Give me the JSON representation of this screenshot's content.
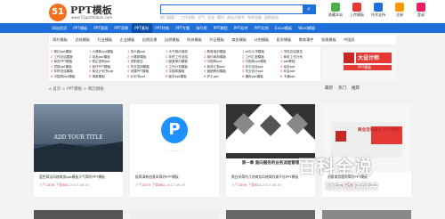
{
  "header": {
    "logo_text": "51",
    "brand": "PPT模板",
    "brand_url": "www.51pptmoban.com",
    "hot_label": "热门搜索：",
    "hot_words": [
      "工作总结",
      "大气",
      "毕业",
      "简约",
      "商业计划书",
      "年终总结",
      "述职报告"
    ],
    "search_icon": "search-icon",
    "quick_links": [
      {
        "label": "收藏本站",
        "color": "#4caf50"
      },
      {
        "label": "上传模板",
        "color": "#e53935"
      },
      {
        "label": "技术支持",
        "color": "#1e6fd9"
      },
      {
        "label": "注册",
        "color": "#ff9800"
      },
      {
        "label": "登录",
        "color": "#e91e63"
      }
    ]
  },
  "nav": [
    "网站首页",
    "PPT模板",
    "PPT图表",
    "PPT背景",
    "PPT素材",
    "PPT特效",
    "PPT专题",
    "排行榜",
    "PPT教程",
    "PPT软件",
    "PPT实例",
    "Excel模板",
    "Word模板"
  ],
  "nav_active": 4,
  "categories": [
    "简约模板",
    "总结模板",
    "行业模板",
    "企业模板",
    "自然风景",
    "自然模板",
    "科技模板",
    "节日模板",
    "商务模板",
    "计划模板",
    "医学模板",
    "教育课件",
    "党政模板",
    "中国风"
  ],
  "rank": [
    [
      "1",
      "简约ppt模板"
    ],
    [
      "1",
      "小清新ppt模板"
    ],
    [
      "1",
      "怎么做ppt"
    ],
    [
      "1",
      "大气简约商务"
    ],
    [
      "1",
      "教育培训模板"
    ],
    [
      "1",
      "pt中小学模板"
    ],
    [
      "1",
      "学校总结报告"
    ],
    [
      "2",
      "工作总结模板"
    ],
    [
      "2",
      "动态ppt模板"
    ],
    [
      "2",
      "小清新模板"
    ],
    [
      "2",
      "年终工作总结"
    ],
    [
      "2",
      "简约商务模板"
    ],
    [
      "2",
      "工作汇报模板"
    ],
    [
      "2",
      "商务工作计划"
    ],
    [
      "3",
      "商务PPT模板"
    ],
    [
      "3",
      "转正述职ppt"
    ],
    [
      "3",
      "述职报告"
    ],
    [
      "3",
      "欧美简约模板"
    ],
    [
      "3",
      "中国风ppt"
    ],
    [
      "3",
      "中国风ppt模板"
    ],
    [
      "3",
      "ppt教程"
    ],
    [
      "4",
      "党政ppt模板"
    ],
    [
      "4",
      "医疗PPT模板"
    ],
    [
      "4",
      "毕业答辩模板"
    ],
    [
      "4",
      "工作计划模板"
    ],
    [
      "4",
      "商务汇报ppt"
    ],
    [
      "4",
      "年中总结ppt"
    ],
    [
      "4",
      "动态ppt"
    ],
    [
      "5",
      "年终总结模板"
    ],
    [
      "5",
      "商业计划书ppt"
    ],
    [
      "5",
      "说课PPT模板"
    ],
    [
      "5",
      "中国风模板"
    ],
    [
      "5",
      "营销策划模板"
    ],
    [
      "5",
      "毕业设计ppt"
    ],
    [
      "5",
      "年会ppt"
    ],
    [
      "6",
      "中国风ppt模板"
    ],
    [
      "6",
      "清新模板"
    ],
    [
      "6",
      "计划书ppt"
    ],
    [
      "6",
      "医学ppt模板"
    ],
    [
      "6",
      "护士ppt"
    ],
    [
      "6",
      "通用ppt模板"
    ],
    [
      "6",
      "卡通ppt"
    ]
  ],
  "banner": {
    "title": "大设计师",
    "subtitle": "PPT模板"
  },
  "breadcrumb": "首页 > PPT模板 > 简历模板",
  "sort": [
    "最新",
    "热门",
    "推荐"
  ],
  "cards": [
    {
      "title": "蓝色简洁风格商务ppt模板大气简约PPT模板",
      "views": "1576",
      "downloads": "861",
      "date": "2017-06-05",
      "thumb_text": "ADD YOUR TITLE"
    },
    {
      "title": "极简清新创意风简约PPT模板",
      "views": "1573",
      "downloads": "861",
      "date": "2017-06-05",
      "thumb_text": "P"
    },
    {
      "title": "黑白灰简约几何商务风格简约扁平化PPT模板",
      "views": "1559",
      "downloads": "811",
      "date": "2017-06-05",
      "thumb_text": "第一章 面向服务的业务流程管理"
    },
    {
      "title": "创意商务服务简约PPT模板",
      "views": "1555",
      "downloads": "812",
      "date": "2017-06-05",
      "thumb_text": "商业活动服务 PPT模板"
    }
  ],
  "watermark": {
    "line1": "百科全说",
    "line2": "助你轻松解决"
  }
}
